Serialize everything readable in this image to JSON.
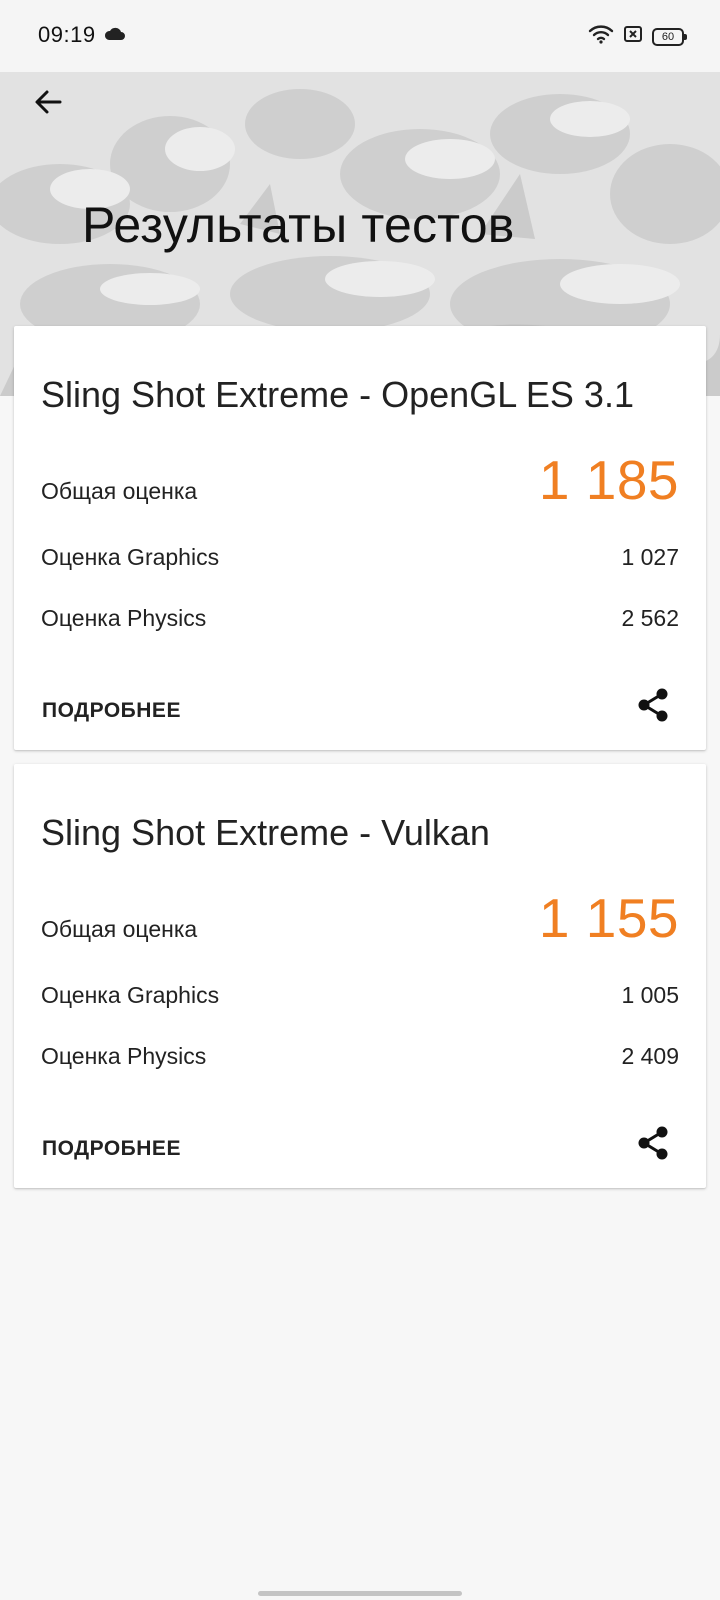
{
  "status_bar": {
    "time": "09:19",
    "battery": "60",
    "icons": [
      "cloud-icon",
      "wifi-icon",
      "notification-icon",
      "battery-icon"
    ]
  },
  "header": {
    "back_icon": "arrow-left-icon",
    "title": "Результаты тестов"
  },
  "colors": {
    "accent": "#f07f22",
    "card_background": "#ffffff",
    "page_background": "#f7f7f7"
  },
  "results": [
    {
      "title": "Sling Shot Extreme - OpenGL ES 3.1",
      "total_label": "Общая оценка",
      "total_value": "1 185",
      "graphics_label": "Оценка Graphics",
      "graphics_value": "1 027",
      "physics_label": "Оценка Physics",
      "physics_value": "2 562",
      "more_label": "ПОДРОБНЕЕ",
      "share_icon": "share-icon"
    },
    {
      "title": "Sling Shot Extreme - Vulkan",
      "total_label": "Общая оценка",
      "total_value": "1 155",
      "graphics_label": "Оценка Graphics",
      "graphics_value": "1 005",
      "physics_label": "Оценка Physics",
      "physics_value": "2 409",
      "more_label": "ПОДРОБНЕЕ",
      "share_icon": "share-icon"
    }
  ]
}
